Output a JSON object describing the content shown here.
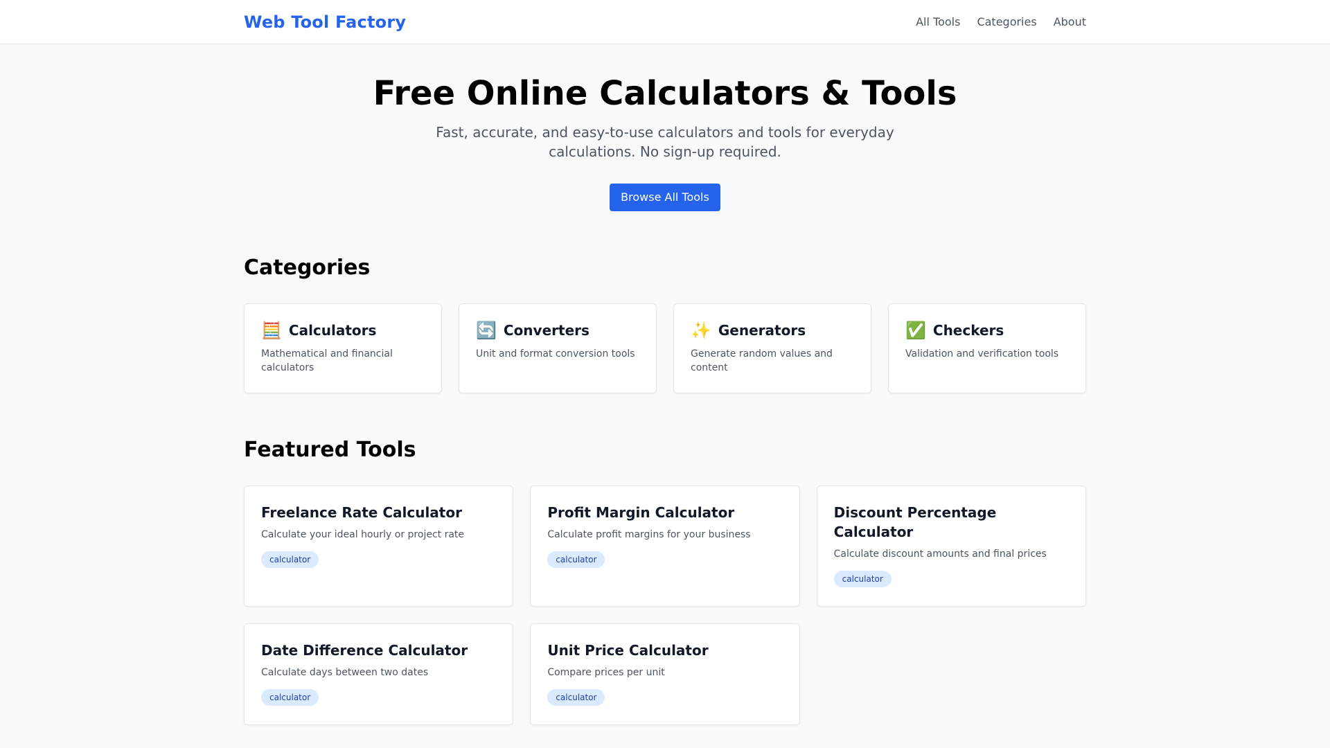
{
  "header": {
    "logo": "Web Tool Factory",
    "nav": [
      {
        "label": "All Tools"
      },
      {
        "label": "Categories"
      },
      {
        "label": "About"
      }
    ]
  },
  "hero": {
    "title": "Free Online Calculators & Tools",
    "subtitle": "Fast, accurate, and easy-to-use calculators and tools for everyday calculations. No sign-up required.",
    "cta": "Browse All Tools"
  },
  "categories": {
    "title": "Categories",
    "items": [
      {
        "icon": "🧮",
        "icon_name": "abacus-icon",
        "name": "Calculators",
        "desc": "Mathematical and financial calculators"
      },
      {
        "icon": "🔄",
        "icon_name": "refresh-arrows-icon",
        "name": "Converters",
        "desc": "Unit and format conversion tools"
      },
      {
        "icon": "✨",
        "icon_name": "sparkles-icon",
        "name": "Generators",
        "desc": "Generate random values and content"
      },
      {
        "icon": "✅",
        "icon_name": "check-mark-icon",
        "name": "Checkers",
        "desc": "Validation and verification tools"
      }
    ]
  },
  "featured": {
    "title": "Featured Tools",
    "tools": [
      {
        "name": "Freelance Rate Calculator",
        "desc": "Calculate your ideal hourly or project rate",
        "tag": "calculator"
      },
      {
        "name": "Profit Margin Calculator",
        "desc": "Calculate profit margins for your business",
        "tag": "calculator"
      },
      {
        "name": "Discount Percentage Calculator",
        "desc": "Calculate discount amounts and final prices",
        "tag": "calculator"
      },
      {
        "name": "Date Difference Calculator",
        "desc": "Calculate days between two dates",
        "tag": "calculator"
      },
      {
        "name": "Unit Price Calculator",
        "desc": "Compare prices per unit",
        "tag": "calculator"
      }
    ]
  },
  "colors": {
    "accent": "#2563eb",
    "tag_bg": "#dbeafe",
    "tag_text": "#1e40af",
    "page_bg": "#f9fafb"
  }
}
